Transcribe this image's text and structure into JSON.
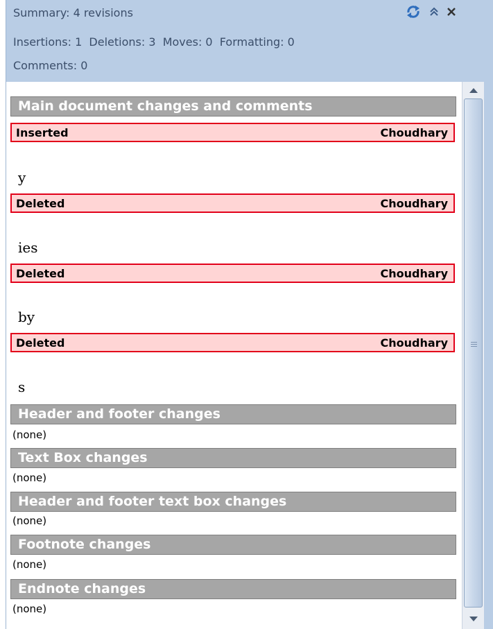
{
  "header": {
    "summary": "Summary: 4 revisions",
    "stats": "Insertions: 1  Deletions: 3  Moves: 0  Formatting: 0",
    "comments": "Comments: 0",
    "icons": [
      "refresh-icon",
      "collapse-icon",
      "close-icon"
    ]
  },
  "main_section": {
    "title": "Main document changes and comments",
    "revisions": [
      {
        "type": "Inserted",
        "author": "Choudhary",
        "text": "y"
      },
      {
        "type": "Deleted",
        "author": "Choudhary",
        "text": "ies"
      },
      {
        "type": "Deleted",
        "author": "Choudhary",
        "text": "by"
      },
      {
        "type": "Deleted",
        "author": "Choudhary",
        "text": "s"
      }
    ]
  },
  "sections": [
    {
      "title": "Header and footer changes",
      "content": "(none)"
    },
    {
      "title": "Text Box changes",
      "content": "(none)"
    },
    {
      "title": "Header and footer text box changes",
      "content": "(none)"
    },
    {
      "title": "Footnote changes",
      "content": "(none)"
    },
    {
      "title": "Endnote changes",
      "content": "(none)"
    }
  ],
  "colors": {
    "header_bg": "#b9cde5",
    "section_bar": "#a6a6a6",
    "revision_bg": "#ffd5d5",
    "revision_border": "#e2001a"
  }
}
